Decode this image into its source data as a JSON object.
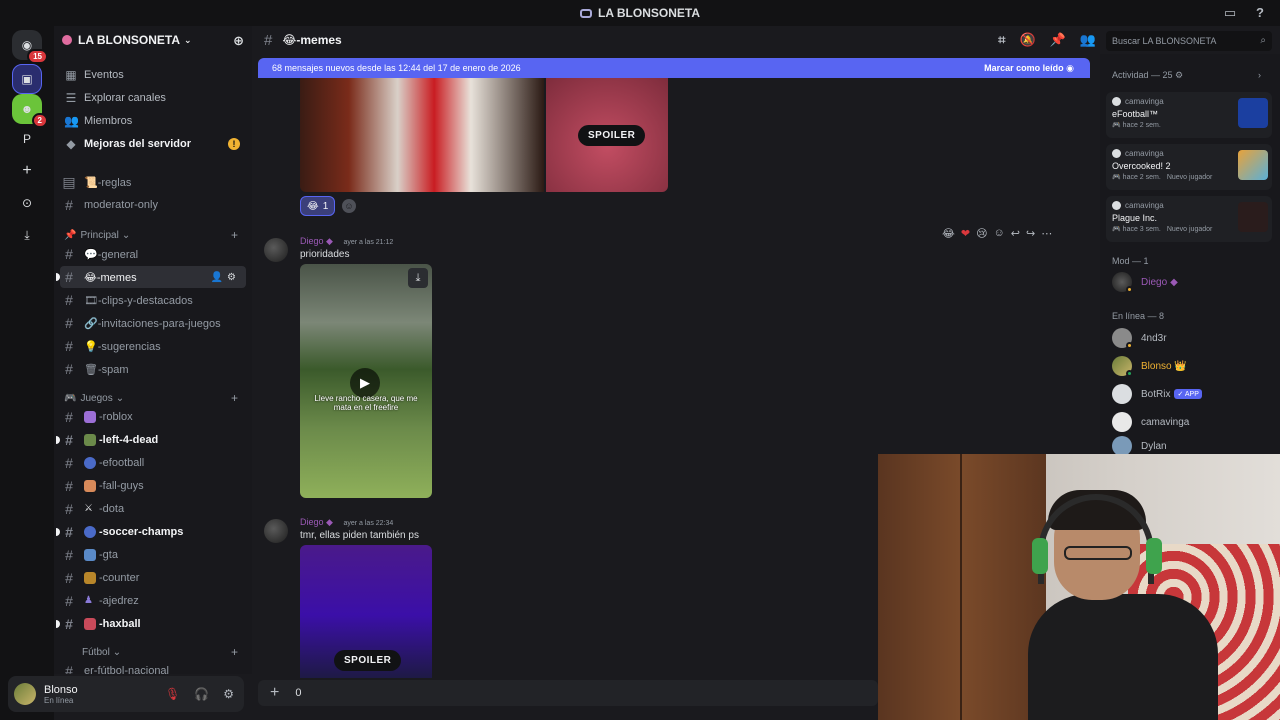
{
  "window": {
    "title": "LA BLONSONETA"
  },
  "rail": {
    "dm_badge": "15",
    "server_badge": "2",
    "letter_server": "P"
  },
  "server": {
    "name": "LA BLONSONETA"
  },
  "nav": [
    {
      "label": "Eventos"
    },
    {
      "label": "Explorar canales"
    },
    {
      "label": "Miembros"
    },
    {
      "label": "Mejoras del servidor",
      "warn": "!"
    }
  ],
  "channels_top": [
    {
      "label": "📜-reglas"
    },
    {
      "label": "moderator-only"
    }
  ],
  "categories": {
    "principal": "Principal",
    "juegos": "Juegos",
    "futbol": "Fútbol"
  },
  "channels_principal": [
    {
      "label": "💬-general"
    },
    {
      "label": "😂-memes"
    },
    {
      "label": "🎞-clips-y-destacados"
    },
    {
      "label": "🔗-invitaciones-para-juegos"
    },
    {
      "label": "💡-sugerencias"
    },
    {
      "label": "🗑-spam"
    }
  ],
  "channels_juegos": [
    {
      "label": "-roblox"
    },
    {
      "label": "-left-4-dead"
    },
    {
      "label": "-efootball"
    },
    {
      "label": "-fall-guys"
    },
    {
      "label": "-dota"
    },
    {
      "label": "-soccer-champs"
    },
    {
      "label": "-gta"
    },
    {
      "label": "-counter"
    },
    {
      "label": "-ajedrez"
    },
    {
      "label": "-haxball"
    }
  ],
  "channels_futbol": [
    {
      "label": "er-fútbol-nacional"
    }
  ],
  "user": {
    "name": "Blonso",
    "status": "En línea"
  },
  "chat": {
    "channel": "😂-memes",
    "search_placeholder": "Buscar LA BLONSONETA",
    "new_messages": "68 mensajes nuevos desde las 12:44 del 17 de enero de 2026",
    "mark_read": "Marcar como leído",
    "spoiler_label": "SPOILER",
    "reaction": {
      "emoji": "😂",
      "count": "1"
    },
    "messages": [
      {
        "author": "Diego",
        "time": "ayer a las 21:12",
        "text": "prioridades",
        "video_caption": "Lleve rancho casera, que me mata en el freefire"
      },
      {
        "author": "Diego",
        "time": "ayer a las 22:34",
        "text": "tmr, ellas piden también ps"
      }
    ],
    "composer_value": "0"
  },
  "members": {
    "activity_header": "Actividad — 25",
    "activities": [
      {
        "user": "camavinga",
        "game": "eFootball™",
        "when": "hace 2 sem.",
        "note": ""
      },
      {
        "user": "camavinga",
        "game": "Overcooked! 2",
        "when": "hace 2 sem.",
        "note": "Nuevo jugador"
      },
      {
        "user": "camavinga",
        "game": "Plague Inc.",
        "when": "hace 3 sem.",
        "note": "Nuevo jugador"
      }
    ],
    "mod_header": "Mod — 1",
    "mods": [
      {
        "name": "Diego"
      }
    ],
    "online_header": "En línea — 8",
    "online": [
      {
        "name": "4nd3r"
      },
      {
        "name": "Blonso 👑"
      },
      {
        "name": "BotRix",
        "tag": "✓ APP"
      },
      {
        "name": "camavinga"
      },
      {
        "name": "Dylan"
      }
    ]
  },
  "colors": {
    "accent": "#5865f2",
    "mod_name": "#9b59b6",
    "owner_name": "#f0b232",
    "online": "#23a55a"
  }
}
